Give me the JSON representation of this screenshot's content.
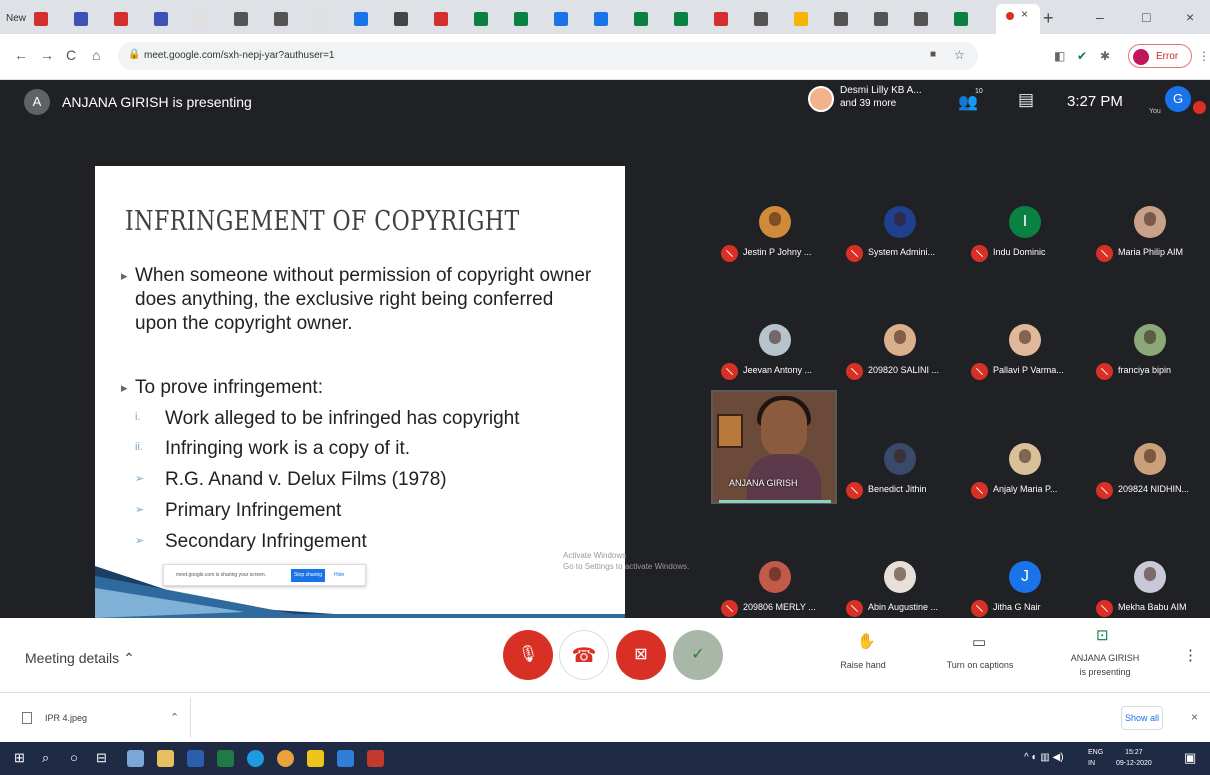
{
  "browser": {
    "first_tab_label": "New",
    "active_tab_close": "×",
    "new_tab": "+",
    "window_buttons": [
      "–",
      "□",
      "×"
    ],
    "url": "meet.google.com/sxh-nepj-yar?authuser=1",
    "error_label": "Error",
    "nav": [
      "←",
      "→",
      "C",
      "⌂"
    ]
  },
  "meet": {
    "presenter_initial": "A",
    "presenter_text": "ANJANA GIRISH is presenting",
    "participants_line1": "Desmi Lilly KB A...",
    "participants_line2": "and 39 more",
    "people_count": "10",
    "time": "3:27 PM",
    "self_initial": "G",
    "you_label": "You"
  },
  "slide": {
    "title": "INFRINGEMENT OF COPYRIGHT",
    "bullets": [
      "When someone without permission of copyright owner does anything, the exclusive right being conferred upon the  copyright owner.",
      "To prove infringement:"
    ],
    "sub_markers": [
      "i.",
      "ii.",
      "➢",
      "➢",
      "➢"
    ],
    "sub_items": [
      "Work alleged to be infringed has copyright",
      "Infringing work is a copy of it.",
      "R.G. Anand v. Delux Films (1978)",
      "Primary Infringement",
      "Secondary Infringement"
    ],
    "share_text": "meet.google.com is sharing your screen.",
    "share_stop": "Stop sharing",
    "share_hide": "Hide",
    "activate_line1": "Activate Windows",
    "activate_line2": "Go to Settings to activate Windows."
  },
  "tiles": [
    {
      "name": "Jestin P Johny ...",
      "avatar": "#d08a3a",
      "letter": ""
    },
    {
      "name": "System Admini...",
      "avatar": "#1f3f8f",
      "letter": ""
    },
    {
      "name": "Indu Dominic",
      "avatar": "#0b8043",
      "letter": "I"
    },
    {
      "name": "Maria Philip AIM",
      "avatar": "#c9a08a",
      "letter": ""
    },
    {
      "name": "Jeevan Antony ...",
      "avatar": "#b8c4cc",
      "letter": ""
    },
    {
      "name": "209820 SALINI ...",
      "avatar": "#d9b08c",
      "letter": ""
    },
    {
      "name": "Pallavi P Varma...",
      "avatar": "#e0b89a",
      "letter": ""
    },
    {
      "name": "franciya bipin",
      "avatar": "#8aa878",
      "letter": ""
    },
    {
      "name": "Benedict Jithin",
      "avatar": "#3a4a6a",
      "letter": ""
    },
    {
      "name": "Anjaly Maria P...",
      "avatar": "#d8c09a",
      "letter": ""
    },
    {
      "name": "209824 NIDHIN...",
      "avatar": "#caa07a",
      "letter": ""
    },
    {
      "name": "209806 MERLY ...",
      "avatar": "#c25a4a",
      "letter": ""
    },
    {
      "name": "Abin Augustine ...",
      "avatar": "#e8e0d8",
      "letter": ""
    },
    {
      "name": "Jitha G Nair",
      "avatar": "#1a73e8",
      "letter": "J"
    },
    {
      "name": "Mekha Babu AIM",
      "avatar": "#c8c8d8",
      "letter": ""
    }
  ],
  "self_tile_name": "ANJANA GIRISH",
  "controls": {
    "meeting_details": "Meeting details",
    "raise_hand": "Raise hand",
    "captions": "Turn on captions",
    "presenting_line1": "ANJANA GIRISH",
    "presenting_line2": "is presenting",
    "more": "⋮"
  },
  "downloads": {
    "file": "IPR 4.jpeg",
    "show_all": "Show all",
    "close": "×"
  },
  "taskbar": {
    "lang_line1": "ENG",
    "lang_line2": "IN",
    "time": "15:27",
    "date": "09-12-2020"
  },
  "colors": {
    "mic_red": "#d93025",
    "accent_blue": "#1a73e8",
    "meet_bg": "#202124",
    "confirm_green": "#4caf50"
  }
}
